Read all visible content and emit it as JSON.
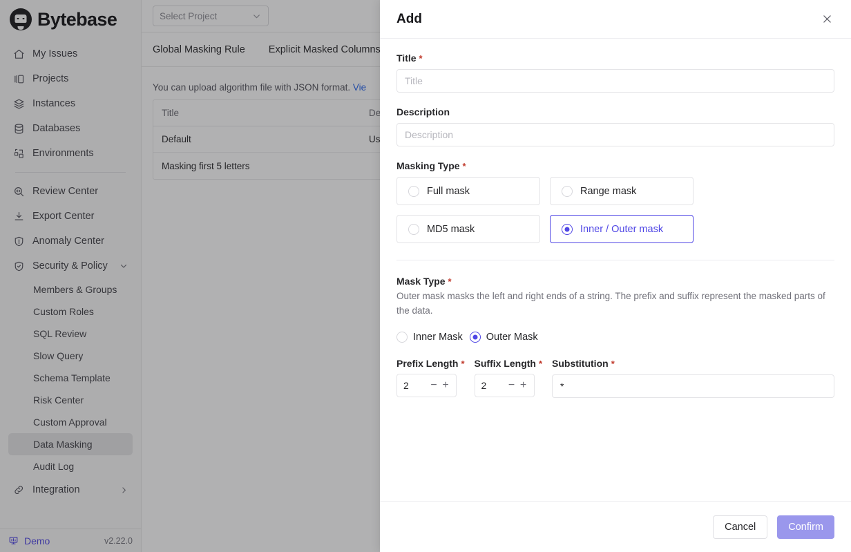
{
  "app": {
    "brand": "Bytebase",
    "version": "v2.22.0",
    "workspace": "Demo"
  },
  "sidebar": {
    "primary_items": [
      {
        "label": "My Issues",
        "icon": "home-icon"
      },
      {
        "label": "Projects",
        "icon": "projects-icon"
      },
      {
        "label": "Instances",
        "icon": "layers-icon"
      },
      {
        "label": "Databases",
        "icon": "database-icon"
      },
      {
        "label": "Environments",
        "icon": "environments-icon"
      }
    ],
    "secondary_items": [
      {
        "label": "Review Center",
        "icon": "review-icon"
      },
      {
        "label": "Export Center",
        "icon": "export-icon"
      },
      {
        "label": "Anomaly Center",
        "icon": "anomaly-icon"
      },
      {
        "label": "Security & Policy",
        "icon": "shield-check-icon",
        "expanded": true
      }
    ],
    "security_children": [
      {
        "label": "Members & Groups",
        "active": false
      },
      {
        "label": "Custom Roles",
        "active": false
      },
      {
        "label": "SQL Review",
        "active": false
      },
      {
        "label": "Slow Query",
        "active": false
      },
      {
        "label": "Schema Template",
        "active": false
      },
      {
        "label": "Risk Center",
        "active": false
      },
      {
        "label": "Custom Approval",
        "active": false
      },
      {
        "label": "Data Masking",
        "active": true
      },
      {
        "label": "Audit Log",
        "active": false
      }
    ],
    "integration": {
      "label": "Integration",
      "icon": "link-icon"
    }
  },
  "main": {
    "project_selector": {
      "placeholder": "Select Project"
    },
    "tabs": [
      {
        "label": "Global Masking Rule"
      },
      {
        "label": "Explicit Masked Columns"
      }
    ],
    "hint": {
      "text": "You can upload algorithm file with JSON format. ",
      "link": "Vie"
    },
    "table": {
      "columns": [
        "Title",
        "Descr"
      ],
      "rows": [
        {
          "title": "Default",
          "description": "Use *"
        },
        {
          "title": "Masking first 5 letters",
          "description": ""
        }
      ]
    }
  },
  "modal": {
    "title": "Add",
    "close_icon": "close-icon",
    "title_field": {
      "label": "Title",
      "required": true,
      "value": "",
      "placeholder": "Title"
    },
    "description_field": {
      "label": "Description",
      "required": false,
      "value": "",
      "placeholder": "Description"
    },
    "masking_type": {
      "label": "Masking Type",
      "required": true,
      "selected": "Inner / Outer mask",
      "options": [
        {
          "label": "Full mask",
          "selected": false
        },
        {
          "label": "Range mask",
          "selected": false
        },
        {
          "label": "MD5 mask",
          "selected": false
        },
        {
          "label": "Inner / Outer mask",
          "selected": true
        }
      ]
    },
    "mask_type": {
      "label": "Mask Type",
      "required": true,
      "description": "Outer mask masks the left and right ends of a string. The prefix and suffix represent the masked parts of the data.",
      "selected": "Outer Mask",
      "options": [
        {
          "label": "Inner Mask",
          "selected": false
        },
        {
          "label": "Outer Mask",
          "selected": true
        }
      ]
    },
    "prefix_length": {
      "label": "Prefix Length",
      "required": true,
      "value": "2",
      "decrement": "−",
      "increment": "+"
    },
    "suffix_length": {
      "label": "Suffix Length",
      "required": true,
      "value": "2",
      "decrement": "−",
      "increment": "+"
    },
    "substitution": {
      "label": "Substitution",
      "required": true,
      "value": "*"
    },
    "footer": {
      "cancel_label": "Cancel",
      "confirm_label": "Confirm"
    }
  },
  "colors": {
    "accent": "#4f46e5",
    "confirm_disabled": "#9a97ec",
    "required_star": "#c0392b",
    "link": "#2563eb"
  }
}
